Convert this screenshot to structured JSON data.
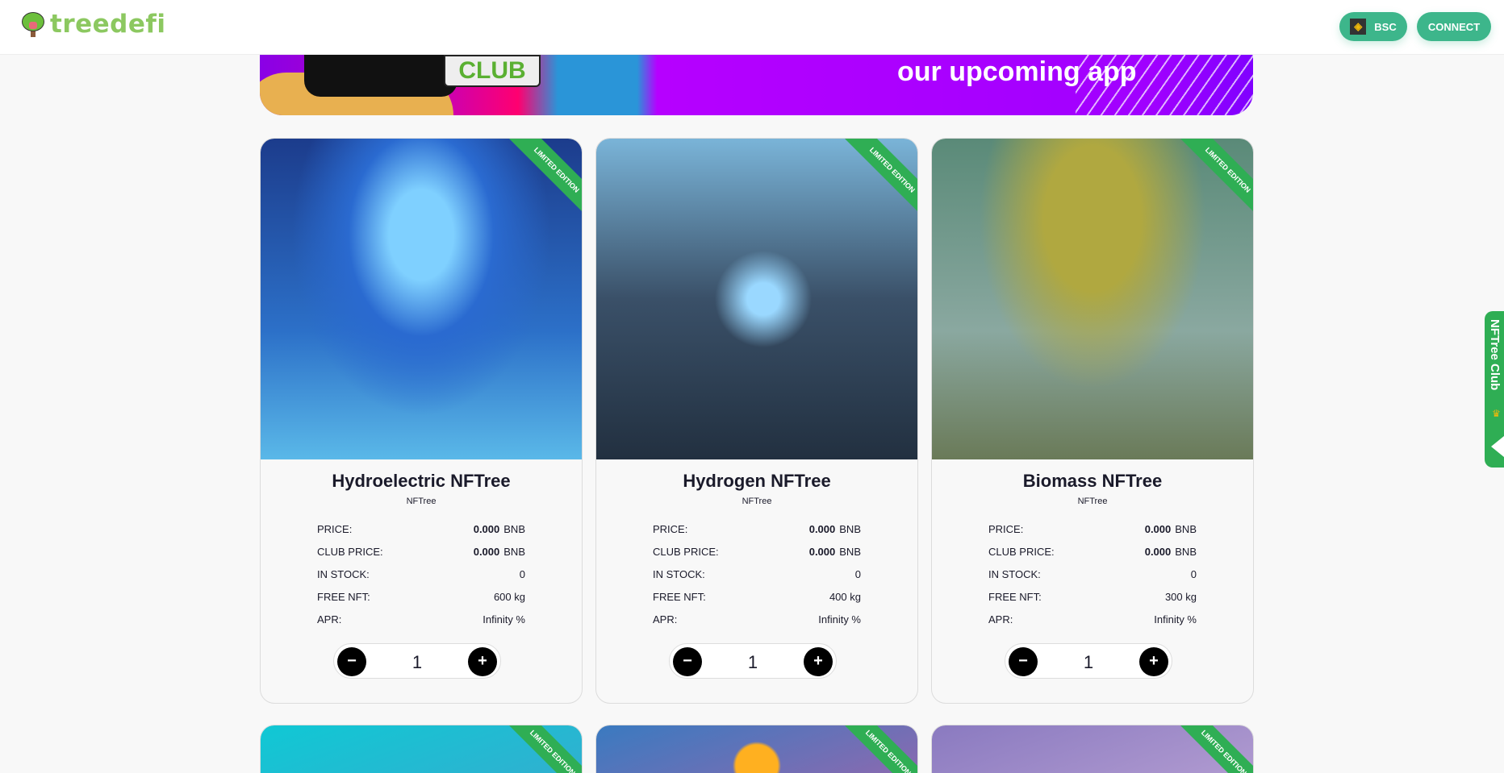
{
  "header": {
    "brand": "treedefi",
    "network_label": "BSC",
    "network_icon": "bnb-icon",
    "connect_label": "CONNECT"
  },
  "banner": {
    "badge": "CLUB",
    "text": "our upcoming app"
  },
  "side_tab": {
    "label": "NFTree Club"
  },
  "ribbon": "LIMITED EDITION",
  "labels": {
    "price": "PRICE:",
    "club_price": "CLUB PRICE:",
    "in_stock": "IN STOCK:",
    "free_nft": "FREE NFT:",
    "apr": "APR:",
    "currency": "BNB"
  },
  "cards": [
    {
      "title": "Hydroelectric NFTree",
      "type": "NFTree",
      "price": "0.000",
      "club_price": "0.000",
      "in_stock": "0",
      "free_nft": "600 kg",
      "apr": "Infinity %",
      "quantity": "1"
    },
    {
      "title": "Hydrogen NFTree",
      "type": "NFTree",
      "price": "0.000",
      "club_price": "0.000",
      "in_stock": "0",
      "free_nft": "400 kg",
      "apr": "Infinity %",
      "quantity": "1"
    },
    {
      "title": "Biomass NFTree",
      "type": "NFTree",
      "price": "0.000",
      "club_price": "0.000",
      "in_stock": "0",
      "free_nft": "300 kg",
      "apr": "Infinity %",
      "quantity": "1"
    }
  ],
  "stepper": {
    "minus": "−",
    "plus": "+"
  }
}
